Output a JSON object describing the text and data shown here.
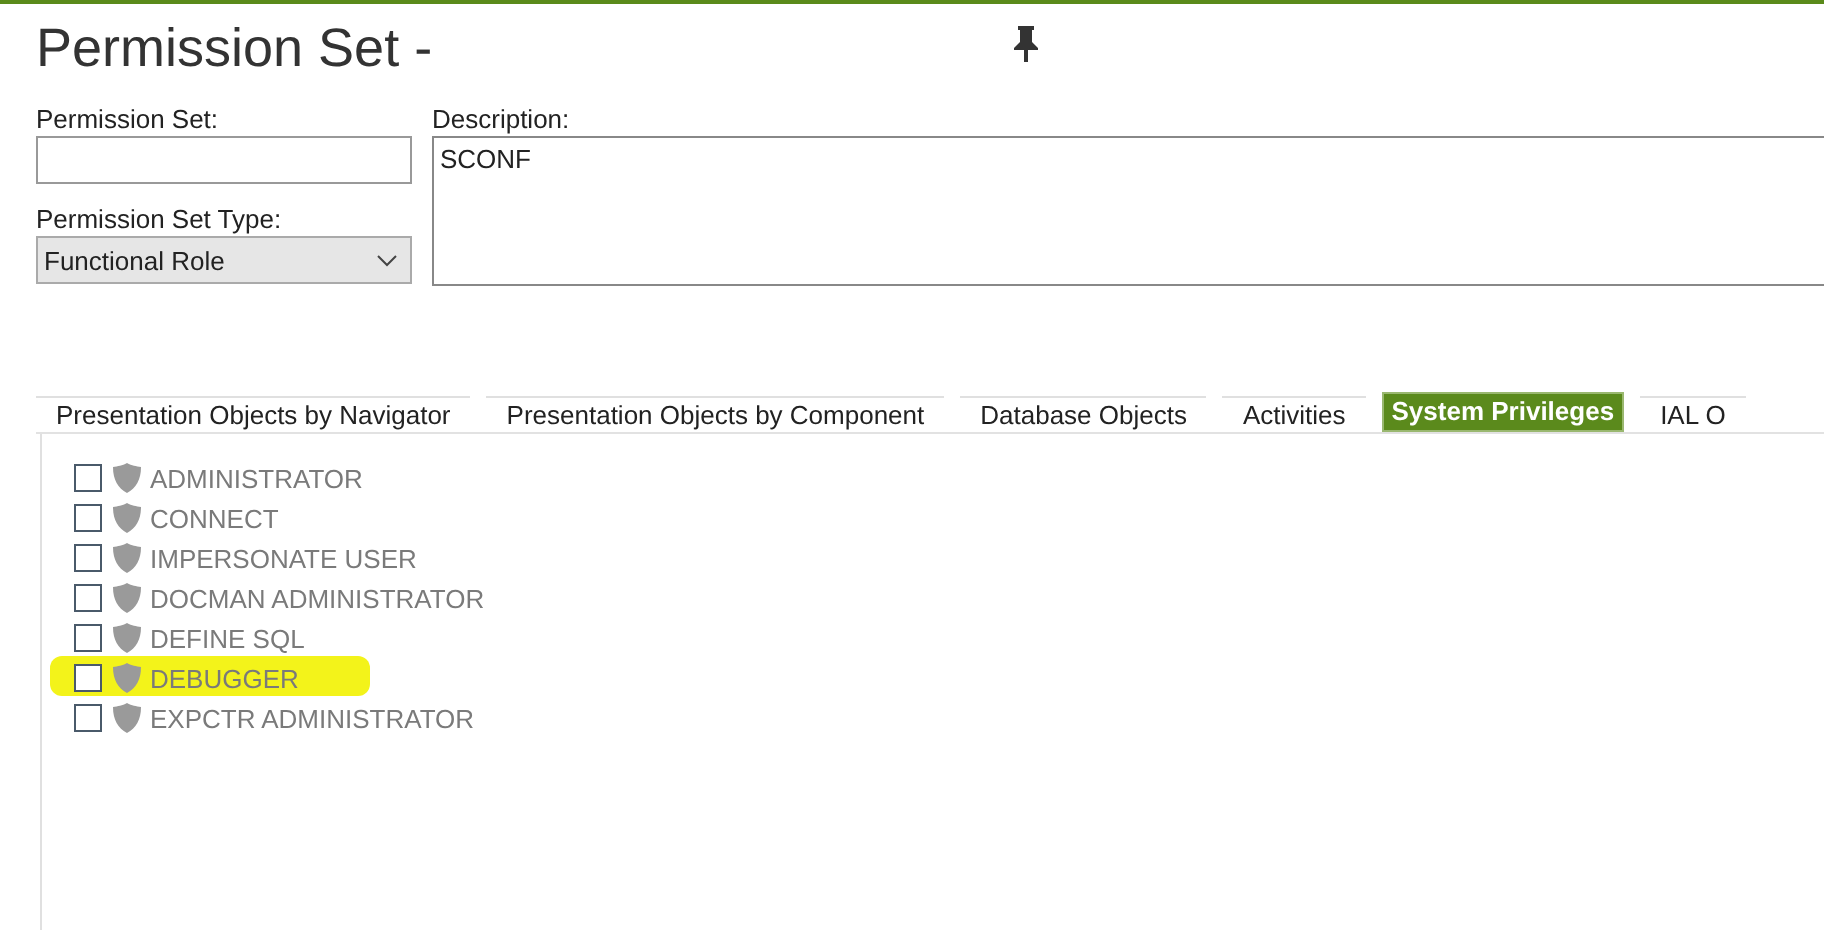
{
  "window": {
    "title": "Permission Set -"
  },
  "permission_set": {
    "label": "Permission Set:"
  },
  "description": {
    "label": "Description:",
    "value": "SCONF"
  },
  "permission_set_type": {
    "label": "Permission Set Type:",
    "value": "Functional Role"
  },
  "tabs": [
    {
      "label": "Presentation Objects by Navigator",
      "selected": false
    },
    {
      "label": "Presentation Objects by Component",
      "selected": false
    },
    {
      "label": "Database Objects",
      "selected": false
    },
    {
      "label": "Activities",
      "selected": false
    },
    {
      "label": "System Privileges",
      "selected": true
    },
    {
      "label": "IAL O",
      "selected": false
    }
  ],
  "privileges": [
    {
      "name": "ADMINISTRATOR",
      "checked": false,
      "highlighted": false
    },
    {
      "name": "CONNECT",
      "checked": false,
      "highlighted": false
    },
    {
      "name": "IMPERSONATE USER",
      "checked": false,
      "highlighted": false
    },
    {
      "name": "DOCMAN ADMINISTRATOR",
      "checked": false,
      "highlighted": false
    },
    {
      "name": "DEFINE SQL",
      "checked": false,
      "highlighted": false
    },
    {
      "name": "DEBUGGER",
      "checked": false,
      "highlighted": true
    },
    {
      "name": "EXPCTR ADMINISTRATOR",
      "checked": false,
      "highlighted": false
    }
  ]
}
